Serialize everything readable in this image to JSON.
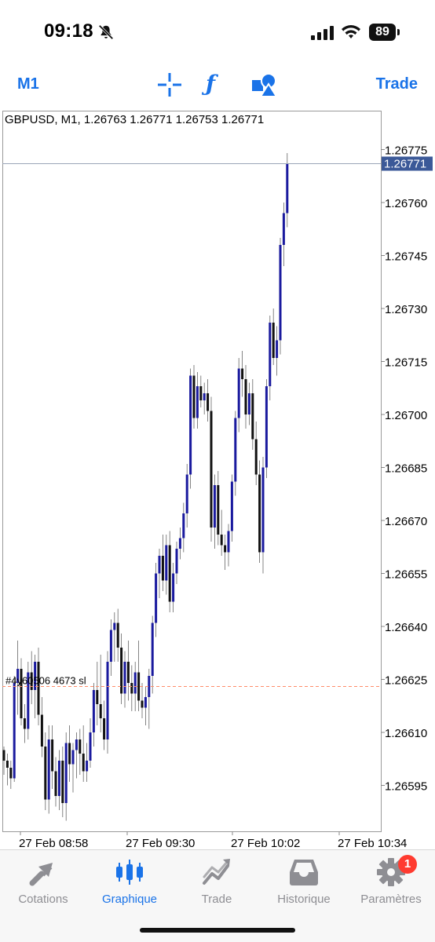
{
  "status_bar": {
    "time": "09:18",
    "battery": "89"
  },
  "toolbar": {
    "timeframe": "M1",
    "trade": "Trade"
  },
  "chart": {
    "header": "GBPUSD, M1, 1.26763 1.26771 1.26753 1.26771",
    "current_price": "1.26771",
    "order_label": "#4y60506 4673 sl",
    "colors": {
      "bull": "#1a1a9e",
      "bear": "#111111",
      "grid": "#c8c8c8",
      "price_tag": "#3b5998",
      "order_line": "#ff8c69"
    }
  },
  "chart_data": {
    "type": "candlestick",
    "symbol": "GBPUSD",
    "timeframe": "M1",
    "ylim": [
      1.26582,
      1.26786
    ],
    "y_ticks": [
      "1.26775",
      "1.26760",
      "1.26745",
      "1.26730",
      "1.26715",
      "1.26700",
      "1.26685",
      "1.26670",
      "1.26655",
      "1.26640",
      "1.26625",
      "1.26610",
      "1.26595"
    ],
    "x_ticks": [
      "27 Feb 08:58",
      "27 Feb 09:30",
      "27 Feb 10:02",
      "27 Feb 10:34"
    ],
    "last": 1.26771,
    "order_level": 1.26623,
    "candles": [
      [
        1.26605,
        1.26606,
        1.26598,
        1.26602
      ],
      [
        1.26602,
        1.26604,
        1.26595,
        1.266
      ],
      [
        1.266,
        1.26602,
        1.26594,
        1.26597
      ],
      [
        1.26597,
        1.26626,
        1.26596,
        1.26624
      ],
      [
        1.26624,
        1.26636,
        1.26615,
        1.26628
      ],
      [
        1.26628,
        1.26631,
        1.26612,
        1.26614
      ],
      [
        1.26614,
        1.26618,
        1.26607,
        1.26611
      ],
      [
        1.26611,
        1.2663,
        1.26608,
        1.26627
      ],
      [
        1.26627,
        1.26633,
        1.26618,
        1.26622
      ],
      [
        1.26622,
        1.26632,
        1.26614,
        1.2663
      ],
      [
        1.2663,
        1.26634,
        1.26612,
        1.26615
      ],
      [
        1.26615,
        1.2662,
        1.26603,
        1.26606
      ],
      [
        1.26606,
        1.2661,
        1.26588,
        1.26591
      ],
      [
        1.26591,
        1.26612,
        1.26587,
        1.26608
      ],
      [
        1.26608,
        1.26612,
        1.26594,
        1.26599
      ],
      [
        1.26599,
        1.26603,
        1.26589,
        1.26592
      ],
      [
        1.26592,
        1.26605,
        1.26588,
        1.26602
      ],
      [
        1.26602,
        1.26606,
        1.26586,
        1.2659
      ],
      [
        1.2659,
        1.2661,
        1.26585,
        1.26607
      ],
      [
        1.26607,
        1.26612,
        1.26596,
        1.26601
      ],
      [
        1.26601,
        1.26607,
        1.26593,
        1.26605
      ],
      [
        1.26605,
        1.2661,
        1.26597,
        1.26608
      ],
      [
        1.26608,
        1.26611,
        1.26598,
        1.26604
      ],
      [
        1.26604,
        1.26612,
        1.26596,
        1.26599
      ],
      [
        1.26599,
        1.26607,
        1.26596,
        1.26602
      ],
      [
        1.26602,
        1.26614,
        1.266,
        1.2661
      ],
      [
        1.2661,
        1.26624,
        1.26606,
        1.26622
      ],
      [
        1.26622,
        1.2663,
        1.26612,
        1.26618
      ],
      [
        1.26618,
        1.26632,
        1.2661,
        1.26614
      ],
      [
        1.26614,
        1.26619,
        1.26605,
        1.26608
      ],
      [
        1.26608,
        1.26633,
        1.26604,
        1.2663
      ],
      [
        1.2663,
        1.26642,
        1.26626,
        1.26639
      ],
      [
        1.26639,
        1.26644,
        1.2663,
        1.26641
      ],
      [
        1.26641,
        1.26645,
        1.2663,
        1.26634
      ],
      [
        1.26634,
        1.26638,
        1.26618,
        1.26621
      ],
      [
        1.26621,
        1.26633,
        1.26617,
        1.2663
      ],
      [
        1.2663,
        1.26636,
        1.26619,
        1.26624
      ],
      [
        1.26624,
        1.26629,
        1.26616,
        1.26621
      ],
      [
        1.26621,
        1.2663,
        1.26616,
        1.26627
      ],
      [
        1.26627,
        1.26636,
        1.26616,
        1.26619
      ],
      [
        1.26619,
        1.26624,
        1.26614,
        1.26617
      ],
      [
        1.26617,
        1.26623,
        1.26612,
        1.2662
      ],
      [
        1.2662,
        1.26628,
        1.26611,
        1.26626
      ],
      [
        1.26626,
        1.26643,
        1.26621,
        1.26641
      ],
      [
        1.26641,
        1.26658,
        1.26637,
        1.26655
      ],
      [
        1.26655,
        1.26662,
        1.26648,
        1.2666
      ],
      [
        1.2666,
        1.26666,
        1.2665,
        1.26653
      ],
      [
        1.26653,
        1.26666,
        1.26649,
        1.26663
      ],
      [
        1.26663,
        1.26667,
        1.26644,
        1.26647
      ],
      [
        1.26647,
        1.26658,
        1.26644,
        1.26655
      ],
      [
        1.26655,
        1.26664,
        1.26652,
        1.26662
      ],
      [
        1.26662,
        1.26668,
        1.26659,
        1.26665
      ],
      [
        1.26665,
        1.26675,
        1.26661,
        1.26672
      ],
      [
        1.26672,
        1.26686,
        1.26668,
        1.26683
      ],
      [
        1.26683,
        1.26713,
        1.26679,
        1.26711
      ],
      [
        1.26711,
        1.26714,
        1.26696,
        1.26699
      ],
      [
        1.26699,
        1.26712,
        1.26696,
        1.26708
      ],
      [
        1.26708,
        1.26711,
        1.26702,
        1.26704
      ],
      [
        1.26704,
        1.26709,
        1.267,
        1.26706
      ],
      [
        1.26706,
        1.2671,
        1.26698,
        1.26701
      ],
      [
        1.26701,
        1.26705,
        1.26664,
        1.26668
      ],
      [
        1.26668,
        1.26683,
        1.26662,
        1.2668
      ],
      [
        1.2668,
        1.26684,
        1.26663,
        1.26666
      ],
      [
        1.26666,
        1.26673,
        1.2666,
        1.26663
      ],
      [
        1.26663,
        1.26666,
        1.26656,
        1.26661
      ],
      [
        1.26661,
        1.26669,
        1.26657,
        1.26667
      ],
      [
        1.26667,
        1.26683,
        1.26664,
        1.26681
      ],
      [
        1.26681,
        1.26701,
        1.26677,
        1.26699
      ],
      [
        1.26699,
        1.26716,
        1.26695,
        1.26713
      ],
      [
        1.26713,
        1.26718,
        1.26705,
        1.2671
      ],
      [
        1.2671,
        1.26714,
        1.26696,
        1.267
      ],
      [
        1.267,
        1.26709,
        1.26697,
        1.26706
      ],
      [
        1.26706,
        1.2671,
        1.2669,
        1.26693
      ],
      [
        1.26693,
        1.26698,
        1.2668,
        1.26683
      ],
      [
        1.26683,
        1.26687,
        1.26658,
        1.26661
      ],
      [
        1.26661,
        1.26688,
        1.26655,
        1.26685
      ],
      [
        1.26685,
        1.2671,
        1.26682,
        1.26708
      ],
      [
        1.26708,
        1.26728,
        1.26704,
        1.26726
      ],
      [
        1.26726,
        1.2673,
        1.26714,
        1.26716
      ],
      [
        1.26716,
        1.26725,
        1.26711,
        1.26721
      ],
      [
        1.26721,
        1.2675,
        1.26717,
        1.26748
      ],
      [
        1.26748,
        1.2676,
        1.26742,
        1.26757
      ],
      [
        1.26757,
        1.26774,
        1.26753,
        1.26771
      ]
    ]
  },
  "tabs": [
    {
      "label": "Cotations",
      "icon": "quotes-arrows-icon"
    },
    {
      "label": "Graphique",
      "icon": "candlestick-chart-icon"
    },
    {
      "label": "Trade",
      "icon": "trade-line-icon"
    },
    {
      "label": "Historique",
      "icon": "history-inbox-icon"
    },
    {
      "label": "Paramètres",
      "icon": "gear-icon",
      "badge": "1"
    }
  ]
}
